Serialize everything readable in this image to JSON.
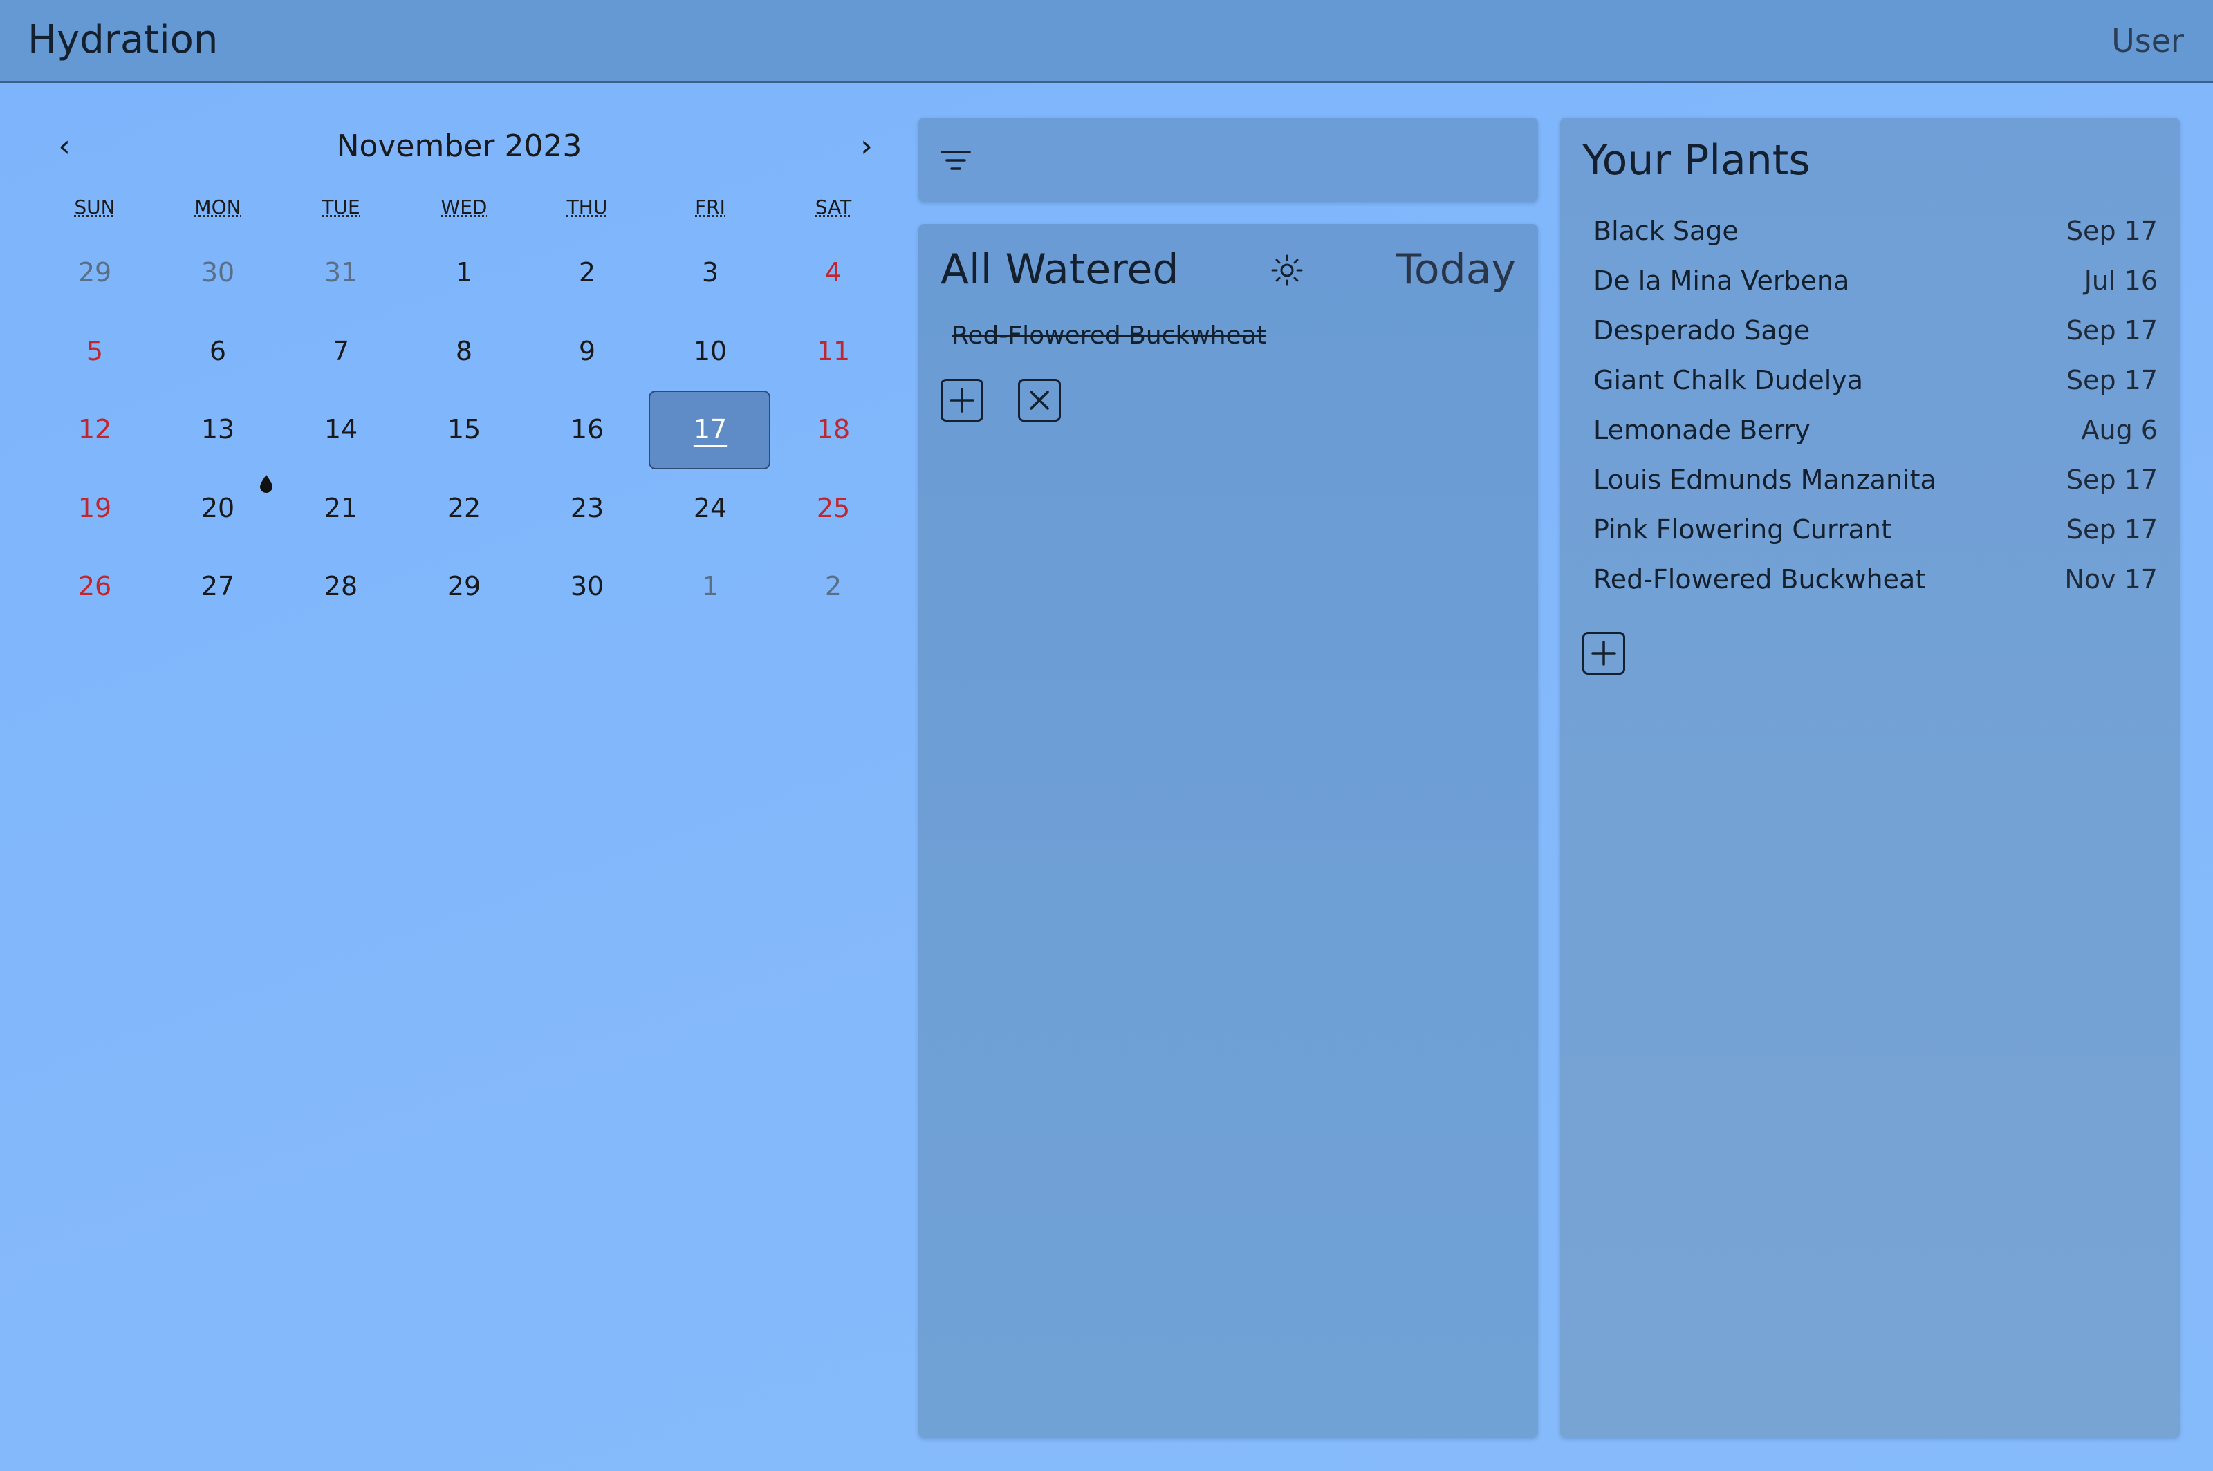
{
  "header": {
    "title": "Hydration",
    "user_label": "User"
  },
  "calendar": {
    "month_label": "November 2023",
    "prev_label": "‹",
    "next_label": "›",
    "weekdays": [
      "SUN",
      "MON",
      "TUE",
      "WED",
      "THU",
      "FRI",
      "SAT"
    ],
    "selected_day": "17",
    "days": [
      {
        "label": "29",
        "muted": true,
        "weekend": false
      },
      {
        "label": "30",
        "muted": true,
        "weekend": false
      },
      {
        "label": "31",
        "muted": true,
        "weekend": false
      },
      {
        "label": "1",
        "muted": false,
        "weekend": false
      },
      {
        "label": "2",
        "muted": false,
        "weekend": false
      },
      {
        "label": "3",
        "muted": false,
        "weekend": false
      },
      {
        "label": "4",
        "muted": false,
        "weekend": true
      },
      {
        "label": "5",
        "muted": false,
        "weekend": true
      },
      {
        "label": "6",
        "muted": false,
        "weekend": false
      },
      {
        "label": "7",
        "muted": false,
        "weekend": false
      },
      {
        "label": "8",
        "muted": false,
        "weekend": false
      },
      {
        "label": "9",
        "muted": false,
        "weekend": false
      },
      {
        "label": "10",
        "muted": false,
        "weekend": false
      },
      {
        "label": "11",
        "muted": false,
        "weekend": true
      },
      {
        "label": "12",
        "muted": false,
        "weekend": true
      },
      {
        "label": "13",
        "muted": false,
        "weekend": false
      },
      {
        "label": "14",
        "muted": false,
        "weekend": false
      },
      {
        "label": "15",
        "muted": false,
        "weekend": false
      },
      {
        "label": "16",
        "muted": false,
        "weekend": false
      },
      {
        "label": "17",
        "muted": false,
        "weekend": false,
        "selected": true
      },
      {
        "label": "18",
        "muted": false,
        "weekend": true
      },
      {
        "label": "19",
        "muted": false,
        "weekend": true
      },
      {
        "label": "20",
        "muted": false,
        "weekend": false
      },
      {
        "label": "21",
        "muted": false,
        "weekend": false
      },
      {
        "label": "22",
        "muted": false,
        "weekend": false
      },
      {
        "label": "23",
        "muted": false,
        "weekend": false
      },
      {
        "label": "24",
        "muted": false,
        "weekend": false
      },
      {
        "label": "25",
        "muted": false,
        "weekend": true
      },
      {
        "label": "26",
        "muted": false,
        "weekend": true
      },
      {
        "label": "27",
        "muted": false,
        "weekend": false
      },
      {
        "label": "28",
        "muted": false,
        "weekend": false
      },
      {
        "label": "29",
        "muted": false,
        "weekend": false
      },
      {
        "label": "30",
        "muted": false,
        "weekend": false
      },
      {
        "label": "1",
        "muted": true,
        "weekend": false
      },
      {
        "label": "2",
        "muted": true,
        "weekend": false
      }
    ],
    "watered_marker_icon": "water-drop-icon"
  },
  "filter_panel": {
    "icon": "filter-icon"
  },
  "watered_panel": {
    "title": "All Watered",
    "theme_icon": "sun-icon",
    "date_label": "Today",
    "items": [
      "Red-Flowered Buckwheat"
    ],
    "add_icon": "plus-square-icon",
    "remove_icon": "x-square-icon"
  },
  "plants_panel": {
    "title": "Your Plants",
    "plants": [
      {
        "name": "Black Sage",
        "date": "Sep 17"
      },
      {
        "name": "De la Mina Verbena",
        "date": "Jul 16"
      },
      {
        "name": "Desperado Sage",
        "date": "Sep 17"
      },
      {
        "name": "Giant Chalk Dudelya",
        "date": "Sep 17"
      },
      {
        "name": "Lemonade Berry",
        "date": "Aug 6"
      },
      {
        "name": "Louis Edmunds Manzanita",
        "date": "Sep 17"
      },
      {
        "name": "Pink Flowering Currant",
        "date": "Sep 17"
      },
      {
        "name": "Red-Flowered Buckwheat",
        "date": "Nov 17"
      }
    ],
    "add_icon": "plus-square-icon"
  },
  "colors": {
    "background": "#7db4fb",
    "header": "#6599d4",
    "panel": "#6c9dd6",
    "selected_day": "#5f8bc6",
    "weekend_text": "#c0262e",
    "muted_text": "#5a6e86"
  }
}
